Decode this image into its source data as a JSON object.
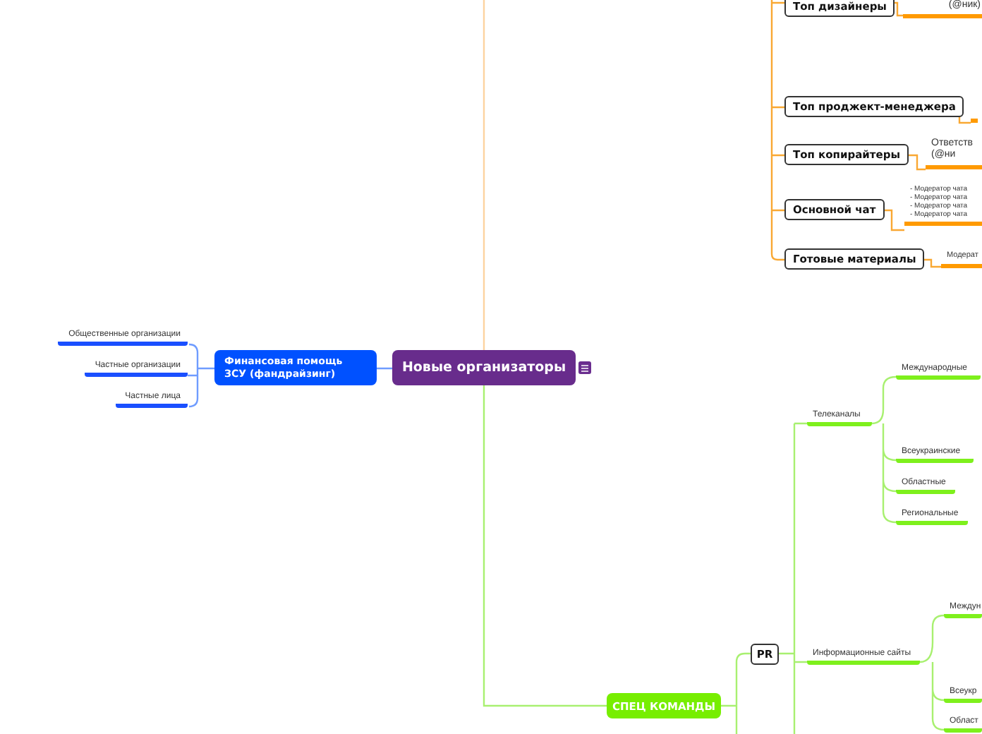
{
  "root": {
    "label": "Новые организаторы"
  },
  "fundraising": {
    "label": "Финансовая помощь ЗСУ (фандрайзинг)",
    "children": [
      "Общественные организации",
      "Частные организации",
      "Частные лица"
    ]
  },
  "teams": [
    {
      "label": "Топ дизайнеры",
      "note": [
        "(@ник)"
      ]
    },
    {
      "label": "Топ проджект-менеджера"
    },
    {
      "label": "Топ копирайтеры",
      "note": [
        "Ответств",
        "(@ни"
      ]
    },
    {
      "label": "Основной чат",
      "note": [
        "- Модератор чата",
        "- Модератор чата",
        "- Модератор чата",
        "- Модератор чата"
      ]
    },
    {
      "label": "Готовые материалы",
      "note": [
        "Модерат"
      ]
    }
  ],
  "spec": {
    "label": "СПЕЦ КОМАНДЫ",
    "pr": "PR",
    "groups": [
      {
        "label": "Телеканалы",
        "children": [
          "Международные",
          "Всеукраинские",
          "Областные",
          "Региональные"
        ]
      },
      {
        "label": "Информационные сайты",
        "children": [
          "Междун",
          "Всеукр",
          "Област"
        ]
      }
    ]
  }
}
